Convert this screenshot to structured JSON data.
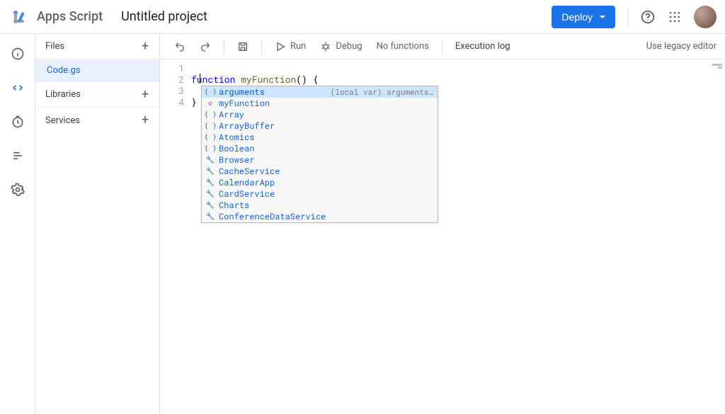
{
  "brand": "Apps Script",
  "project_title": "Untitled project",
  "deploy_label": "Deploy",
  "legacy_label": "Use legacy editor",
  "sidebar": {
    "files_label": "Files",
    "libraries_label": "Libraries",
    "services_label": "Services",
    "file_name": "Code.gs"
  },
  "toolbar": {
    "run": "Run",
    "debug": "Debug",
    "fn_picker": "No functions",
    "exec_log": "Execution log"
  },
  "code": {
    "lines": [
      "1",
      "2",
      "3",
      "4"
    ],
    "l1_kw": "function",
    "l1_fn": " myFunction",
    "l1_rest": "() {",
    "l3": "}"
  },
  "autocomplete": {
    "items": [
      {
        "icon": "var",
        "label": "arguments",
        "detail": "(local var) arguments…",
        "selected": true
      },
      {
        "icon": "fn",
        "label": "myFunction"
      },
      {
        "icon": "var",
        "label": "Array"
      },
      {
        "icon": "var",
        "label": "ArrayBuffer"
      },
      {
        "icon": "var",
        "label": "Atomics"
      },
      {
        "icon": "var",
        "label": "Boolean"
      },
      {
        "icon": "svc",
        "label": "Browser"
      },
      {
        "icon": "svc",
        "label": "CacheService"
      },
      {
        "icon": "svc",
        "label": "CalendarApp"
      },
      {
        "icon": "svc",
        "label": "CardService"
      },
      {
        "icon": "svc",
        "label": "Charts"
      },
      {
        "icon": "svc",
        "label": "ConferenceDataService"
      }
    ]
  }
}
